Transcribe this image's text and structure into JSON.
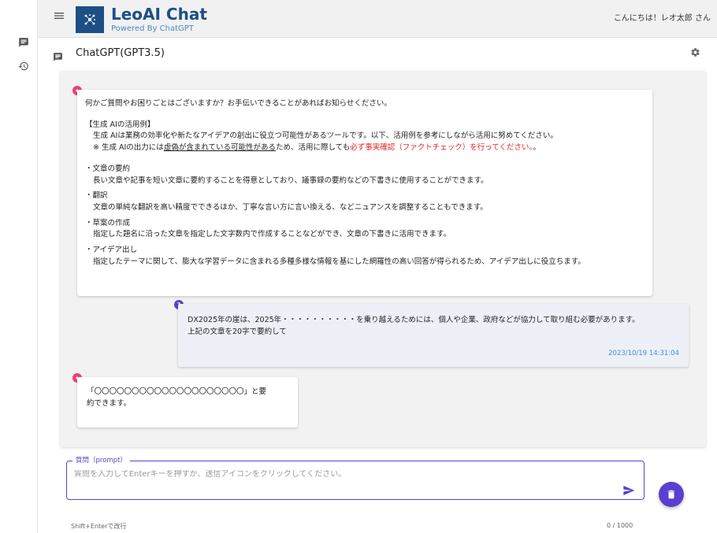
{
  "rail": {
    "chat_icon": "chat-icon",
    "history_icon": "history-icon"
  },
  "header": {
    "app_title": "LeoAI Chat",
    "app_subtitle": "Powered By ChatGPT",
    "greeting": "こんにちは！レオ太郎 さん"
  },
  "subheader": {
    "model_title": "ChatGPT(GPT3.5)"
  },
  "messages": {
    "ai_intro": {
      "greeting": "何かご質問やお困りごとはございますか？お手伝いできることがあればお知らせください。",
      "examples_heading": "【生成 AIの活用例】",
      "examples_desc": "生成 AIは業務の効率化や新たなアイデアの創出に役立つ可能性があるツールです。以下、活用例を参考にしながら活用に努めてください。",
      "note_prefix": "※ 生成 AIの出力には",
      "note_underline": "虚偽が含まれている可能性がある",
      "note_middle": "ため、活用に際しても",
      "note_red": "必ず事実確認（ファクトチェック）を行ってください。",
      "note_suffix": "。",
      "items": [
        {
          "title": "・文章の要約",
          "body": "長い文章や記事を短い文章に要約することを得意としており、議事録の要約などの下書きに使用することができます。"
        },
        {
          "title": "・翻訳",
          "body": "文章の単純な翻訳を高い精度でできるほか、丁寧な言い方に言い換える、などニュアンスを調整することもできます。"
        },
        {
          "title": "・草案の作成",
          "body": "指定した題名に沿った文章を指定した文字数内で作成することなどができ、文章の下書きに活用できます。"
        },
        {
          "title": "・アイデア出し",
          "body": "指定したテーマに関して、膨大な学習データに含まれる多種多様な情報を基にした網羅性の高い回答が得られるため、アイデア出しに役立ちます。"
        }
      ]
    },
    "user_question": {
      "line1": "DX2025年の崖は、2025年・・・・・・・・・・を乗り越えるためには、個人や企業、政府などが協力して取り組む必要があります。",
      "line2": "上記の文章を20字で要約して",
      "timestamp": "2023/10/19 14:31:04"
    },
    "ai_reply": {
      "line1": "「〇〇〇〇〇〇〇〇〇〇〇〇〇〇〇〇〇〇〇〇」と要",
      "line2": "約できます。"
    }
  },
  "prompt": {
    "legend": "質問（prompt）",
    "placeholder": "質問を入力してEnterキーを押すか、送信アイコンをクリックしてください。",
    "value": "",
    "hint": "Shift+Enterで改行",
    "counter": "0 / 1000"
  },
  "colors": {
    "brand": "#1c4f86",
    "accent": "#5b3fd0",
    "ai_avatar": "#e8417a",
    "timestamp": "#3d8fd6",
    "warning": "#e52222"
  }
}
